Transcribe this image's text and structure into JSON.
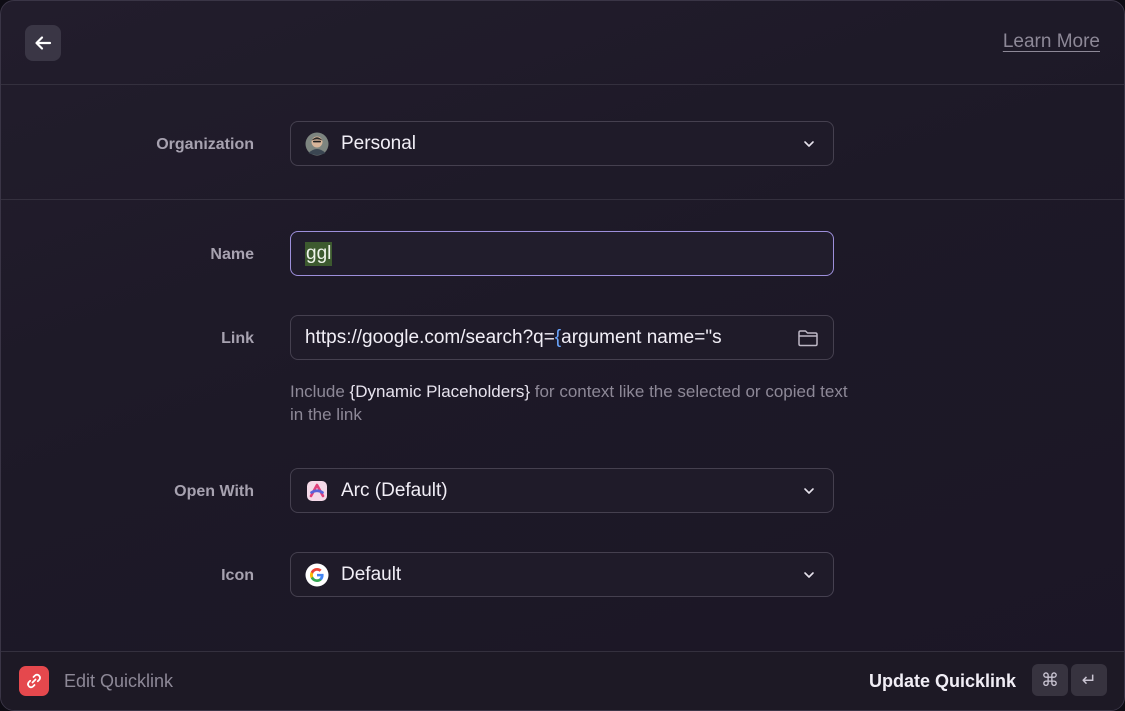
{
  "header": {
    "learn_more": "Learn More"
  },
  "form": {
    "organization": {
      "label": "Organization",
      "value": "Personal"
    },
    "name": {
      "label": "Name",
      "value": "ggl"
    },
    "link": {
      "label": "Link",
      "value_prefix": "https://google.com/search?q=",
      "value_brace": "{",
      "value_rest": "argument name=\"s",
      "hint_prefix": "Include ",
      "hint_placeholder": "{Dynamic Placeholders}",
      "hint_suffix": " for context like the selected or copied text in the link"
    },
    "open_with": {
      "label": "Open With",
      "value": "Arc (Default)"
    },
    "icon": {
      "label": "Icon",
      "value": "Default"
    }
  },
  "footer": {
    "title": "Edit Quicklink",
    "action": "Update Quicklink",
    "shortcut_cmd": "⌘",
    "shortcut_enter": "↵"
  },
  "colors": {
    "accent_focus": "#9d8fdb",
    "selection": "#3d5a2f",
    "brace": "#6aa6ff",
    "app_icon": "#e5484d"
  }
}
